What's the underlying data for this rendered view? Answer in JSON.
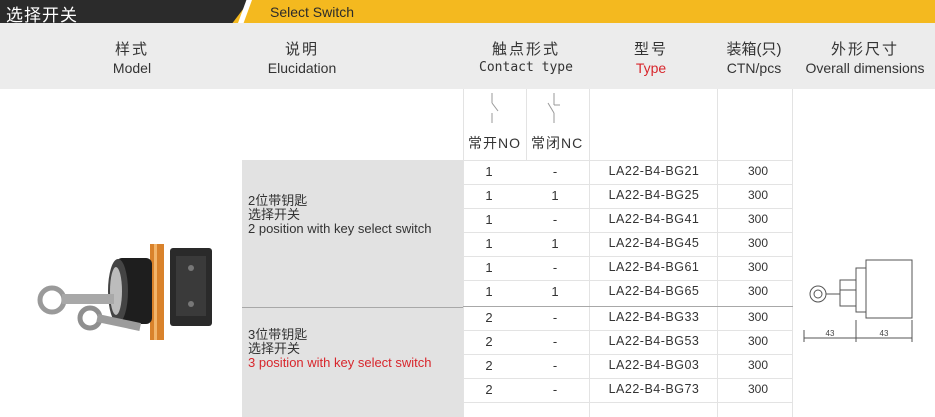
{
  "title": {
    "cn": "选择开关",
    "en": "Select Switch"
  },
  "header": {
    "model": {
      "cn": "样式",
      "en": "Model"
    },
    "elucidation": {
      "cn": "说明",
      "en": "Elucidation"
    },
    "contact": {
      "cn": "触点形式",
      "en": "Contact type"
    },
    "type": {
      "cn": "型号",
      "en": "Type"
    },
    "ctn": {
      "cn": "装箱(只)",
      "en": "CTN/pcs"
    },
    "overall": {
      "cn": "外形尺寸",
      "en": "Overall dimensions"
    }
  },
  "contact_labels": {
    "no": "常开NO",
    "nc": "常闭NC"
  },
  "groups": [
    {
      "line1": "2位带钥匙",
      "line2": "选择开关",
      "line3": "2 position with key select switch"
    },
    {
      "line1": "3位带钥匙",
      "line2": "选择开关",
      "line3": "3 position with key select switch"
    }
  ],
  "rows": [
    {
      "no": "1",
      "nc": "-",
      "type": "LA22-B4-BG21",
      "ctn": "300"
    },
    {
      "no": "1",
      "nc": "1",
      "type": "LA22-B4-BG25",
      "ctn": "300"
    },
    {
      "no": "1",
      "nc": "-",
      "type": "LA22-B4-BG41",
      "ctn": "300"
    },
    {
      "no": "1",
      "nc": "1",
      "type": "LA22-B4-BG45",
      "ctn": "300"
    },
    {
      "no": "1",
      "nc": "-",
      "type": "LA22-B4-BG61",
      "ctn": "300"
    },
    {
      "no": "1",
      "nc": "1",
      "type": "LA22-B4-BG65",
      "ctn": "300"
    },
    {
      "no": "2",
      "nc": "-",
      "type": "LA22-B4-BG33",
      "ctn": "300"
    },
    {
      "no": "2",
      "nc": "-",
      "type": "LA22-B4-BG53",
      "ctn": "300"
    },
    {
      "no": "2",
      "nc": "-",
      "type": "LA22-B4-BG03",
      "ctn": "300"
    },
    {
      "no": "2",
      "nc": "-",
      "type": "LA22-B4-BG73",
      "ctn": "300"
    }
  ],
  "dimensions": {
    "left": "43",
    "right": "43"
  }
}
